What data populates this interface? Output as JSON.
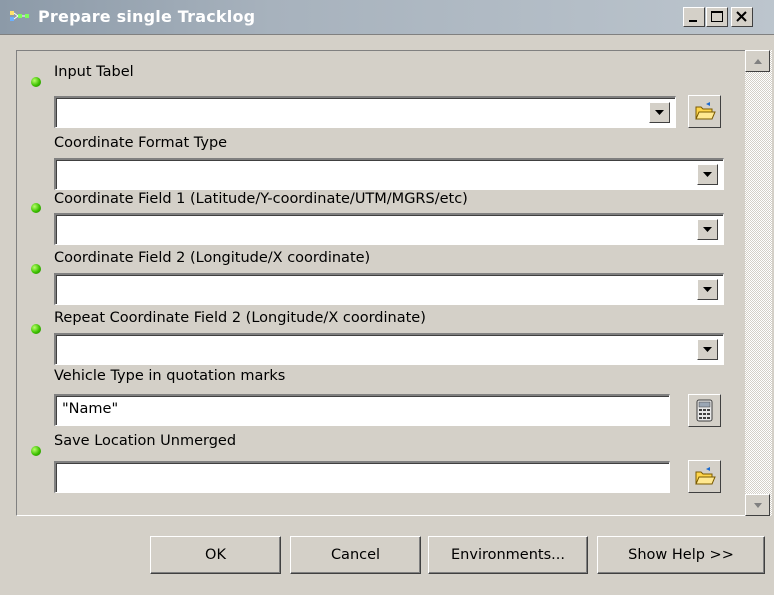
{
  "window": {
    "title": "Prepare single Tracklog",
    "buttons": [
      "minimize-icon",
      "maximize-icon",
      "close-icon"
    ]
  },
  "params": [
    {
      "label": "Input Tabel",
      "required": true,
      "value": "",
      "control": "dropdown+browse"
    },
    {
      "label": "Coordinate Format Type",
      "required": false,
      "value": "",
      "control": "dropdown"
    },
    {
      "label": "Coordinate Field 1 (Latitude/Y-coordinate/UTM/MGRS/etc)",
      "required": true,
      "value": "",
      "control": "dropdown"
    },
    {
      "label": "Coordinate Field 2 (Longitude/X coordinate)",
      "required": true,
      "value": "",
      "control": "dropdown"
    },
    {
      "label": "Repeat Coordinate Field 2 (Longitude/X coordinate)",
      "required": true,
      "value": "",
      "control": "dropdown"
    },
    {
      "label": "Vehicle Type in quotation marks",
      "required": false,
      "value": "\"Name\"",
      "control": "text+calculator"
    },
    {
      "label": "Save Location Unmerged",
      "required": true,
      "value": "",
      "control": "text+browse"
    }
  ],
  "footer": {
    "ok": "OK",
    "cancel": "Cancel",
    "environments": "Environments...",
    "show_help": "Show Help >>"
  },
  "colors": {
    "dialog_bg": "#d4d0c8",
    "required_dot": "#3cc000",
    "title_text": "#ffffff"
  }
}
